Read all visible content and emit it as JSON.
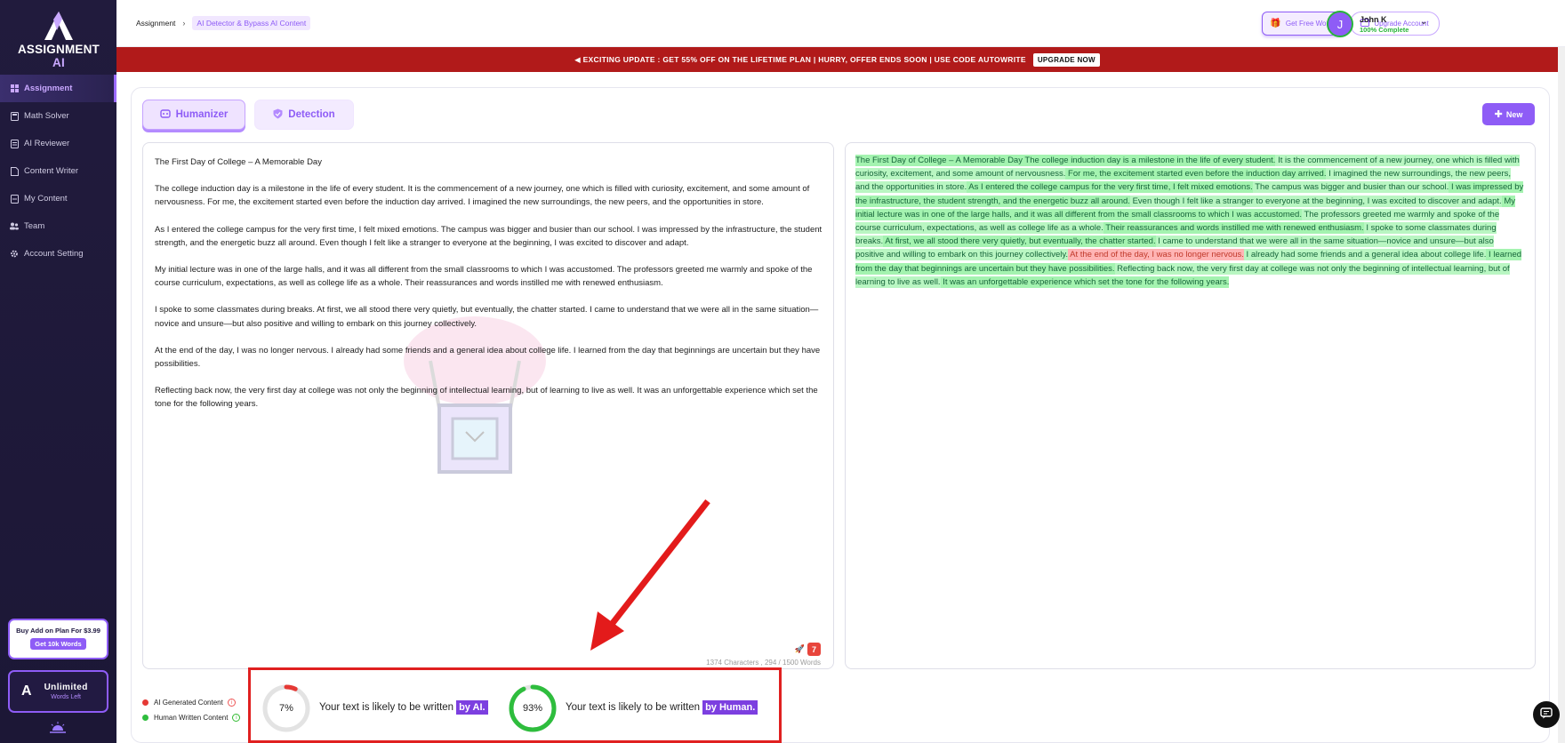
{
  "brand": {
    "name": "ASSIGNMENT",
    "suffix": "AI"
  },
  "sidebar": {
    "items": [
      {
        "label": "Assignment",
        "icon": "grid-icon",
        "active": true
      },
      {
        "label": "Math Solver",
        "icon": "calculator-icon"
      },
      {
        "label": "AI Reviewer",
        "icon": "document-icon"
      },
      {
        "label": "Content Writer",
        "icon": "file-icon"
      },
      {
        "label": "My Content",
        "icon": "folder-icon"
      },
      {
        "label": "Team",
        "icon": "team-icon"
      },
      {
        "label": "Account Setting",
        "icon": "gear-icon"
      }
    ],
    "promo": {
      "title": "Buy Add on Plan For $3.99",
      "button": "Get 10k Words"
    },
    "unlimited": {
      "icon": "A",
      "title": "Unlimited",
      "subtitle": "Words Left"
    }
  },
  "header": {
    "breadcrumb": {
      "root": "Assignment",
      "current": "AI Detector & Bypass AI Content"
    },
    "free_words": "Get Free Words",
    "upgrade": "Upgrade Account",
    "user": {
      "initial": "J",
      "name": "John K",
      "status": "100% Complete"
    }
  },
  "banner": {
    "text": "◀ EXCITING UPDATE : GET 55% OFF ON THE LIFETIME PLAN | HURRY, OFFER ENDS SOON | USE CODE AUTOWRITE",
    "button": "UPGRADE NOW"
  },
  "tabs": {
    "humanizer": "Humanizer",
    "detection": "Detection",
    "new": "New"
  },
  "editor": {
    "title": "The First Day of College – A Memorable Day",
    "paragraphs": [
      "The college induction day is a milestone in the life of every student. It is the commencement of a new journey, one which is filled with curiosity, excitement, and some amount of nervousness. For me, the excitement started even before the induction day arrived. I imagined the new surroundings, the new peers, and the opportunities in store.",
      "As I entered the college campus for the very first time, I felt mixed emotions. The campus was bigger and busier than our school. I was impressed by the infrastructure, the student strength, and the energetic buzz all around. Even though I felt like a stranger to everyone at the beginning, I was excited to discover and adapt.",
      "My initial lecture was in one of the large halls, and it was all different from the small classrooms to which I was accustomed. The professors greeted me warmly and spoke of the course curriculum, expectations, as well as college life as a whole. Their reassurances and words instilled me with renewed enthusiasm.",
      "I spoke to some classmates during breaks. At first, we all stood there very quietly, but eventually, the chatter started. I came to understand that we were all in the same situation—novice and unsure—but also positive and willing to embark on this journey collectively.",
      "At the end of the day, I was no longer nervous. I already had some friends and a general idea about college life. I learned from the day that beginnings are uncertain but they have possibilities.",
      "Reflecting back now, the very first day at college was not only the beginning of intellectual learning, but of learning to live as well. It was an unforgettable experience which set the tone for the following years."
    ],
    "counter": "1374 Characters , 294 / 1500 Words"
  },
  "output": {
    "segments": [
      {
        "text": "The First Day of College – A Memorable Day The college induction day is a milestone in the life of every student.",
        "type": "human"
      },
      {
        "text": " It is the commencement of a new journey, one which is filled with curiosity, excitement, and some amount of nervousness.",
        "type": "human"
      },
      {
        "text": " For me, the excitement started even before the induction day arrived.",
        "type": "human"
      },
      {
        "text": " I imagined the new surroundings, the new peers, and the opportunities in store.",
        "type": "human"
      },
      {
        "text": " As I entered the college campus for the very first time, I felt mixed emotions.",
        "type": "human"
      },
      {
        "text": " The campus was bigger and busier than our school.",
        "type": "human"
      },
      {
        "text": " I was impressed by the infrastructure, the student strength, and the energetic buzz all around.",
        "type": "human"
      },
      {
        "text": " Even though I felt like a stranger to everyone at the beginning, I was excited to discover and adapt.",
        "type": "human"
      },
      {
        "text": " My initial lecture was in one of the large halls, and it was all different from the small classrooms to which I was accustomed.",
        "type": "human"
      },
      {
        "text": " The professors greeted me warmly and spoke of the course curriculum, expectations, as well as college life as a whole.",
        "type": "human"
      },
      {
        "text": " Their reassurances and words instilled me with renewed enthusiasm.",
        "type": "human"
      },
      {
        "text": " I spoke to some classmates during breaks.",
        "type": "human"
      },
      {
        "text": " At first, we all stood there very quietly, but eventually, the chatter started.",
        "type": "human"
      },
      {
        "text": " I came to understand that we were all in the same situation—novice and unsure—but also positive and willing to embark on this journey collectively.",
        "type": "human"
      },
      {
        "text": " At the end of the day, I was no longer nervous.",
        "type": "ai"
      },
      {
        "text": " I already had some friends and a general idea about college life.",
        "type": "human"
      },
      {
        "text": " I learned from the day that beginnings are uncertain but they have possibilities.",
        "type": "human"
      },
      {
        "text": " Reflecting back now, the very first day at college was not only the beginning of intellectual learning, but of learning to live as well.",
        "type": "human"
      },
      {
        "text": " It was an unforgettable experience which set the tone for the following years.",
        "type": "human"
      }
    ]
  },
  "legend": {
    "ai": "AI Generated Content",
    "human": "Human Written Content"
  },
  "results": {
    "ai": {
      "percent": 7,
      "label": "7%",
      "text": "Your text is likely to be written",
      "pill": "by AI."
    },
    "human": {
      "percent": 93,
      "label": "93%",
      "text": "Your text is likely to be written",
      "pill": "by Human."
    }
  },
  "colors": {
    "accent": "#8e5cf6",
    "sidebar": "#211b3d",
    "banner": "#b11a1a",
    "ai": "#e53935",
    "human": "#2ebd3d"
  }
}
